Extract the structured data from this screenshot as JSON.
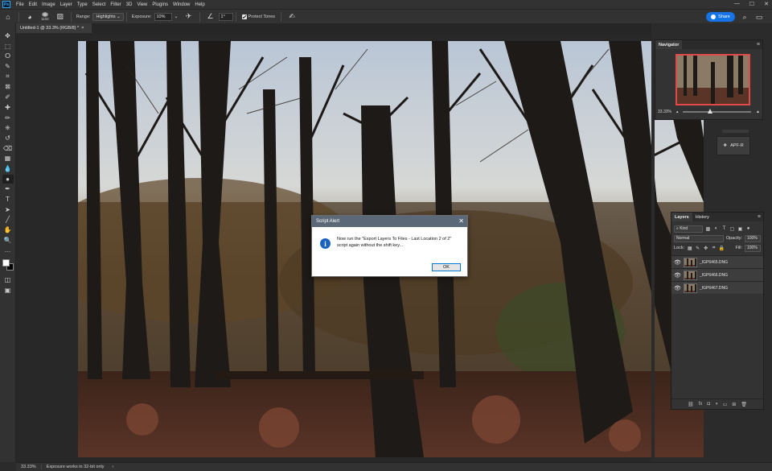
{
  "app": {
    "logo": "Ps"
  },
  "menu": [
    "File",
    "Edit",
    "Image",
    "Layer",
    "Type",
    "Select",
    "Filter",
    "3D",
    "View",
    "Plugins",
    "Window",
    "Help"
  ],
  "window_controls": [
    "—",
    "☐",
    "✕"
  ],
  "options": {
    "brush_size": "1102",
    "range_label": "Range:",
    "range_value": "Highlights",
    "exposure_label": "Exposure:",
    "exposure_value": "10%",
    "angle_value": "1°",
    "protect_tones_label": "Protect Tones",
    "share_label": "Share"
  },
  "document": {
    "tab_title": "Untitled-1 @ 33.3% (RGB/8) *",
    "close": "×"
  },
  "tools": [
    "move-icon",
    "marquee-icon",
    "lasso-icon",
    "quick-select-icon",
    "crop-icon",
    "frame-icon",
    "eyedropper-icon",
    "healing-icon",
    "brush-icon",
    "stamp-icon",
    "history-brush-icon",
    "eraser-icon",
    "gradient-icon",
    "blur-icon",
    "dodge-icon",
    "pen-icon",
    "type-icon",
    "path-select-icon",
    "line-icon",
    "hand-icon",
    "zoom-icon",
    "more-icon"
  ],
  "tool_glyphs": [
    "✥",
    "⬚",
    "ⵔ",
    "✎",
    "⌗",
    "⊠",
    "✐",
    "✚",
    "✏",
    "⎈",
    "↺",
    "⌫",
    "▦",
    "💧",
    "●",
    "✒",
    "T",
    "➤",
    "╱",
    "✋",
    "🔍",
    "…"
  ],
  "active_tool_index": 14,
  "colors": {
    "foreground": "#ffffff",
    "background": "#000000",
    "accent": "#1473e6",
    "nav_frame": "#e24a4a"
  },
  "status": {
    "zoom": "33.33%",
    "message": "Exposure works in 32-bit only"
  },
  "navigator": {
    "tab": "Navigator",
    "zoom": "33.33%",
    "zoom_fraction": 0.4
  },
  "plugin_button": {
    "label": "APF-R"
  },
  "layers_panel": {
    "tabs": [
      "Layers",
      "History"
    ],
    "filter_label": "Kind",
    "blend_mode": "Normal",
    "opacity_label": "Opacity:",
    "opacity_value": "100%",
    "lock_label": "Lock:",
    "fill_label": "Fill:",
    "fill_value": "100%",
    "layers": [
      {
        "name": "_IGP6465.DNG"
      },
      {
        "name": "_IGP6466.DNG"
      },
      {
        "name": "_IGP6467.DNG"
      }
    ],
    "footer_icons": [
      "link-icon",
      "fx-icon",
      "mask-icon",
      "adjustment-icon",
      "group-icon",
      "new-layer-icon",
      "trash-icon"
    ],
    "footer_glyphs": [
      "⛓",
      "fx",
      "◘",
      "◑",
      "▭",
      "⊞",
      "🗑"
    ]
  },
  "dialog": {
    "title": "Script Alert",
    "message_line1": "Now run the \"Export Layers To Files - Last Location 2 of 2\"",
    "message_line2": "script again without the shift key...",
    "ok_label": "OK",
    "close": "✕",
    "icon": "i"
  }
}
